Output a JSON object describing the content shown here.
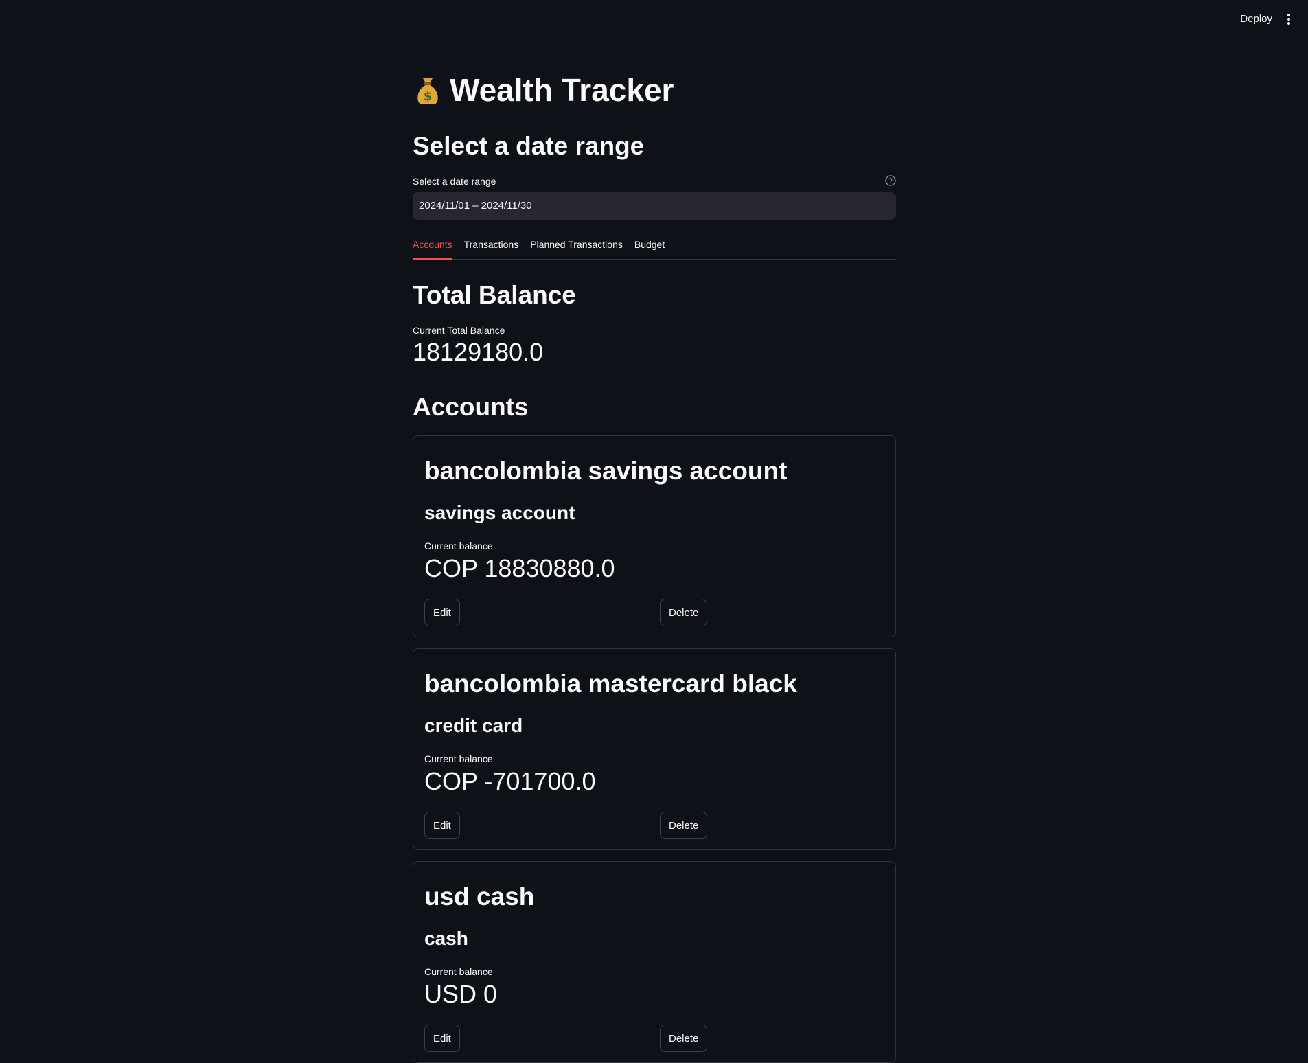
{
  "header": {
    "deploy_label": "Deploy",
    "menu_icon": "more-vertical-icon"
  },
  "app": {
    "title": "Wealth Tracker",
    "title_icon": "money-bag-icon"
  },
  "date_section": {
    "heading": "Select a date range",
    "input_label": "Select a date range",
    "value": "2024/11/01 – 2024/11/30",
    "help_icon": "help-circle-icon"
  },
  "tabs": [
    {
      "label": "Accounts",
      "active": true
    },
    {
      "label": "Transactions",
      "active": false
    },
    {
      "label": "Planned Transactions",
      "active": false
    },
    {
      "label": "Budget",
      "active": false
    }
  ],
  "total": {
    "heading": "Total Balance",
    "label": "Current Total Balance",
    "value": "18129180.0"
  },
  "accounts_heading": "Accounts",
  "accounts": [
    {
      "name": "bancolombia savings account",
      "type": "savings account",
      "balance_label": "Current balance",
      "balance": "COP 18830880.0",
      "edit_label": "Edit",
      "delete_label": "Delete"
    },
    {
      "name": "bancolombia mastercard black",
      "type": "credit card",
      "balance_label": "Current balance",
      "balance": "COP -701700.0",
      "edit_label": "Edit",
      "delete_label": "Delete"
    },
    {
      "name": "usd cash",
      "type": "cash",
      "balance_label": "Current balance",
      "balance": "USD 0",
      "edit_label": "Edit",
      "delete_label": "Delete"
    }
  ],
  "colors": {
    "background": "#0e1117",
    "accent": "#ff4b4b",
    "input_bg": "#262730",
    "border": "#31333f"
  }
}
